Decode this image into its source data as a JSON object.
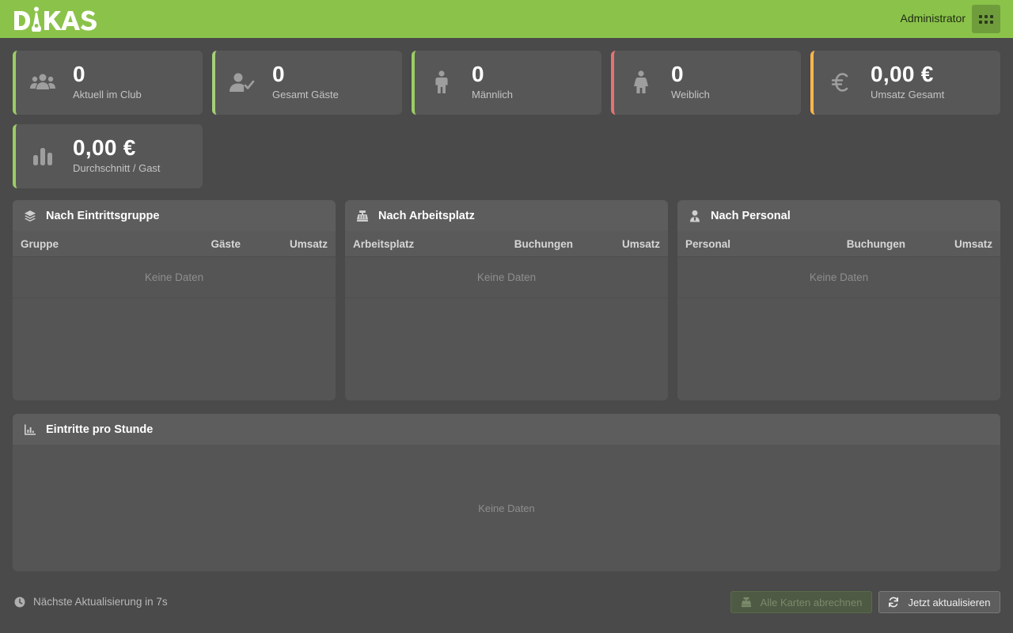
{
  "header": {
    "logo_text": "DIKAS",
    "user_label": "Administrator",
    "brand_color": "#8bc34a"
  },
  "stats": [
    {
      "value": "0",
      "label": "Aktuell im Club",
      "icon": "users-group-icon",
      "accent": "#9ccc65"
    },
    {
      "value": "0",
      "label": "Gesamt Gäste",
      "icon": "user-check-icon",
      "accent": "#a5d07a"
    },
    {
      "value": "0",
      "label": "Männlich",
      "icon": "male-icon",
      "accent": "#9ccc65"
    },
    {
      "value": "0",
      "label": "Weiblich",
      "icon": "female-icon",
      "accent": "#e57373"
    },
    {
      "value": "0,00 €",
      "label": "Umsatz Gesamt",
      "icon": "euro-icon",
      "accent": "#ffb74d"
    },
    {
      "value": "0,00 €",
      "label": "Durchschnitt / Gast",
      "icon": "bar-chart-icon",
      "accent": "#9ccc65"
    }
  ],
  "panels": {
    "group": {
      "title": "Nach Eintrittsgruppe",
      "columns": [
        "Gruppe",
        "Gäste",
        "Umsatz"
      ],
      "empty": "Keine Daten"
    },
    "workplace": {
      "title": "Nach Arbeitsplatz",
      "columns": [
        "Arbeitsplatz",
        "Buchungen",
        "Umsatz"
      ],
      "empty": "Keine Daten"
    },
    "staff": {
      "title": "Nach Personal",
      "columns": [
        "Personal",
        "Buchungen",
        "Umsatz"
      ],
      "empty": "Keine Daten"
    },
    "hourly": {
      "title": "Eintritte pro Stunde",
      "empty": "Keine Daten"
    }
  },
  "footer": {
    "next_update": "Nächste Aktualisierung in 7s",
    "settle_all_label": "Alle Karten abrechnen",
    "refresh_label": "Jetzt aktualisieren"
  }
}
